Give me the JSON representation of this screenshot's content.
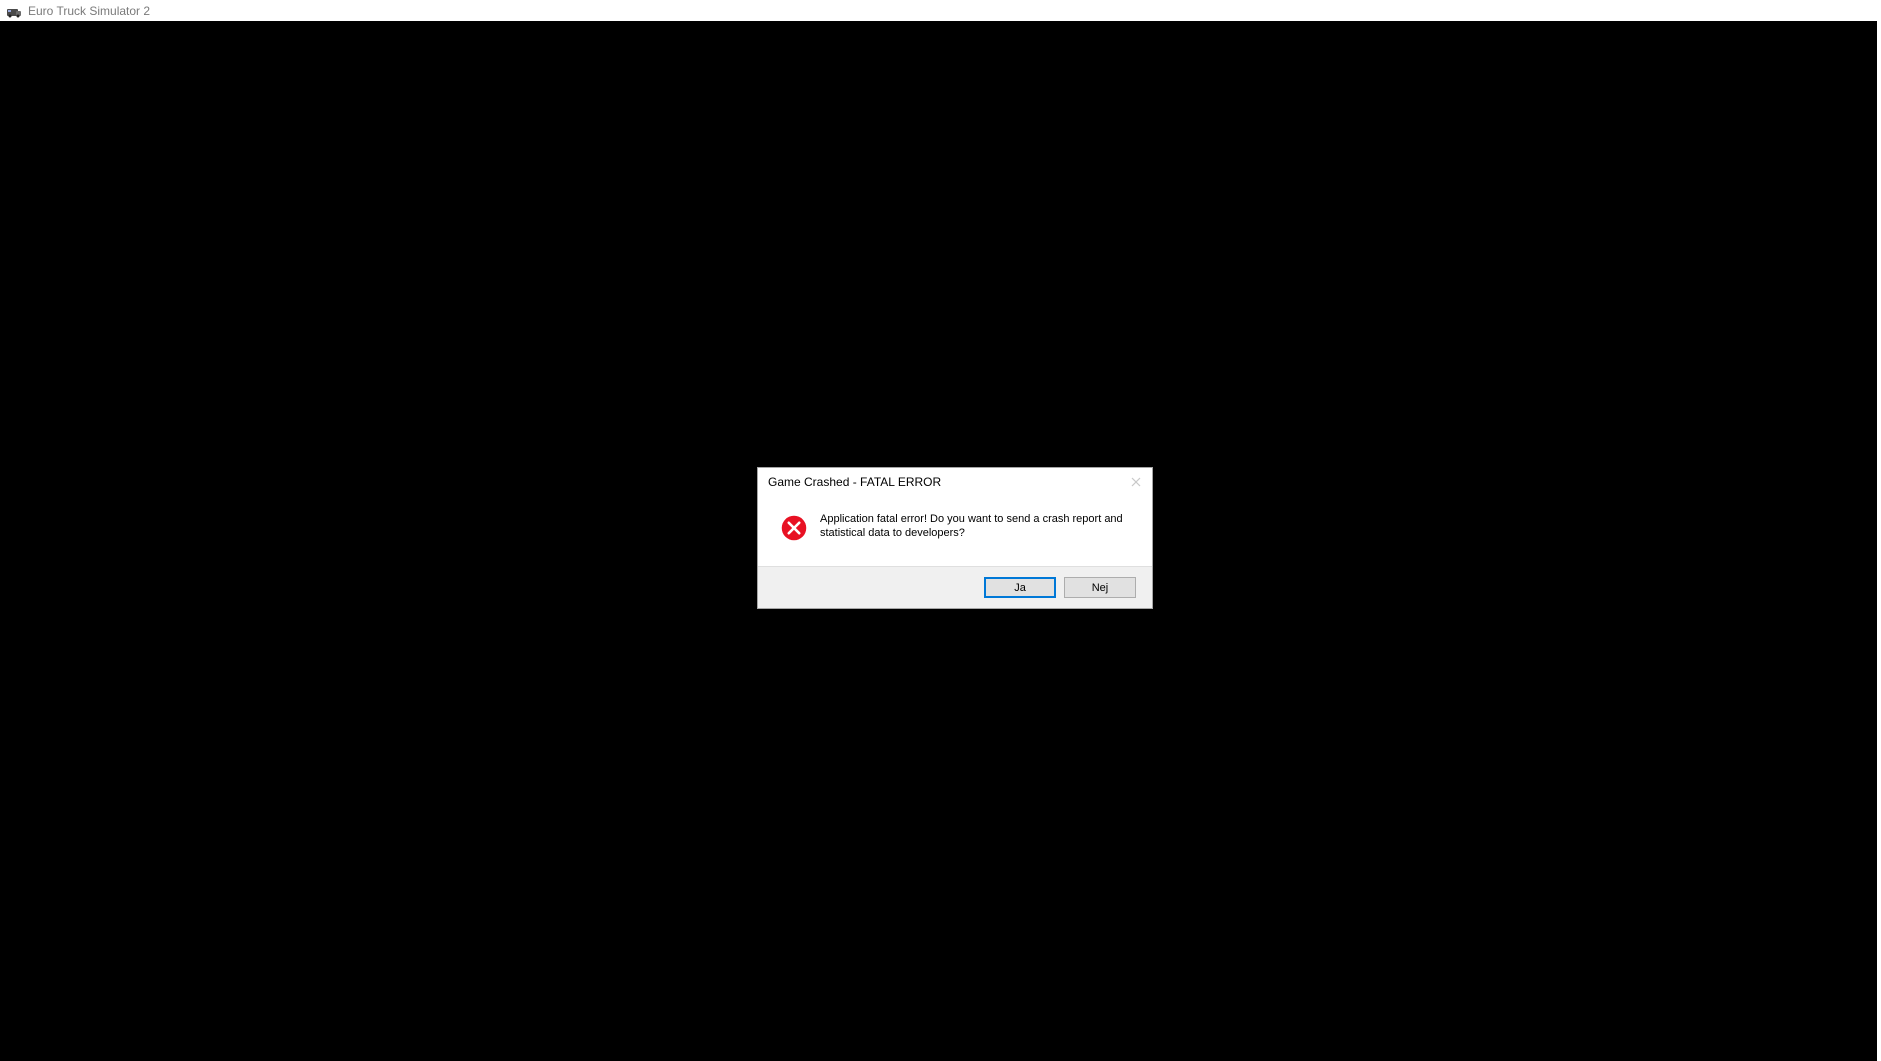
{
  "app": {
    "title": "Euro Truck Simulator 2"
  },
  "dialog": {
    "title": "Game Crashed - FATAL ERROR",
    "message": "Application fatal error! Do you want to send a crash report and statistical data to developers?",
    "yes_label": "Ja",
    "no_label": "Nej"
  }
}
